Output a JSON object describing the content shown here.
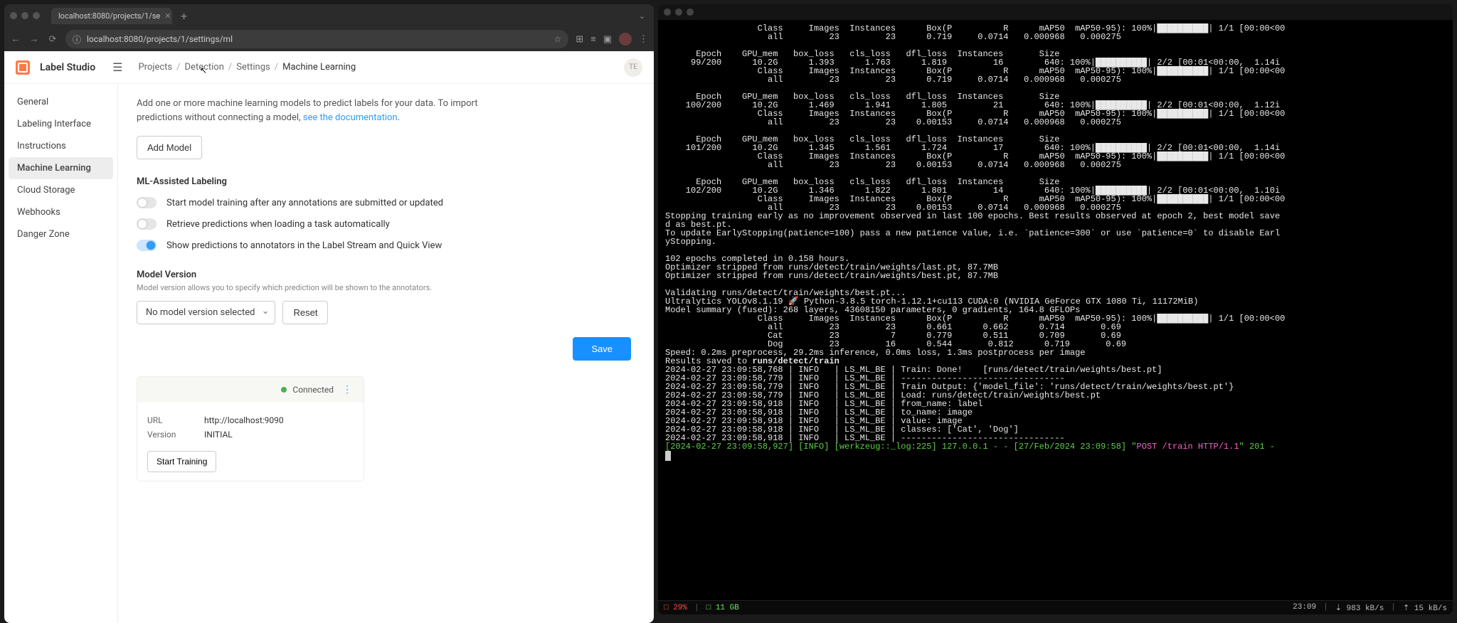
{
  "browser": {
    "tab_title": "localhost:8080/projects/1/se",
    "url": "localhost:8080/projects/1/settings/ml"
  },
  "header": {
    "brand": "Label Studio",
    "user_initials": "TE",
    "crumbs": {
      "projects": "Projects",
      "detection": "Detection",
      "settings": "Settings",
      "ml": "Machine Learning"
    }
  },
  "sidebar": {
    "general": "General",
    "labeling": "Labeling Interface",
    "instructions": "Instructions",
    "ml": "Machine Learning",
    "cloud": "Cloud Storage",
    "webhooks": "Webhooks",
    "danger": "Danger Zone"
  },
  "main": {
    "desc_pre": "Add one or more machine learning models to predict labels for your data. To import predictions without connecting a model, ",
    "desc_link": "see the documentation",
    "add_model": "Add Model",
    "assist_h": "ML-Assisted Labeling",
    "tog1": "Start model training after any annotations are submitted or updated",
    "tog2": "Retrieve predictions when loading a task automatically",
    "tog3": "Show predictions to annotators in the Label Stream and Quick View",
    "mv_h": "Model Version",
    "mv_hint": "Model version allows you to specify which prediction will be shown to the annotators.",
    "mv_select": "No model version selected",
    "reset": "Reset",
    "save": "Save"
  },
  "card": {
    "connected": "Connected",
    "url_k": "URL",
    "url_v": "http://localhost:9090",
    "ver_k": "Version",
    "ver_v": "INITIAL",
    "start": "Start Training"
  },
  "term": {
    "lines": [
      "                  Class     Images  Instances      Box(P          R      mAP50  mAP50-95): 100%|██████████| 1/1 [00:00<00",
      "                    all         23         23      0.719     0.0714   0.000968   0.000275",
      "",
      "      Epoch    GPU_mem   box_loss   cls_loss   dfl_loss  Instances       Size",
      "     99/200      10.2G      1.393      1.763      1.819         16        640: 100%|██████████| 2/2 [00:01<00:00,  1.14i",
      "                  Class     Images  Instances      Box(P          R      mAP50  mAP50-95): 100%|██████████| 1/1 [00:00<00",
      "                    all         23         23      0.719     0.0714   0.000968   0.000275",
      "",
      "      Epoch    GPU_mem   box_loss   cls_loss   dfl_loss  Instances       Size",
      "    100/200      10.2G      1.469      1.941      1.805         21        640: 100%|██████████| 2/2 [00:01<00:00,  1.12i",
      "                  Class     Images  Instances      Box(P          R      mAP50  mAP50-95): 100%|██████████| 1/1 [00:00<00",
      "                    all         23         23    0.00153     0.0714   0.000968   0.000275",
      "",
      "      Epoch    GPU_mem   box_loss   cls_loss   dfl_loss  Instances       Size",
      "    101/200      10.2G      1.345      1.561      1.724         17        640: 100%|██████████| 2/2 [00:01<00:00,  1.14i",
      "                  Class     Images  Instances      Box(P          R      mAP50  mAP50-95): 100%|██████████| 1/1 [00:00<00",
      "                    all         23         23    0.00153     0.0714   0.000968   0.000275",
      "",
      "      Epoch    GPU_mem   box_loss   cls_loss   dfl_loss  Instances       Size",
      "    102/200      10.2G      1.346      1.822      1.801         14        640: 100%|██████████| 2/2 [00:01<00:00,  1.10i",
      "                  Class     Images  Instances      Box(P          R      mAP50  mAP50-95): 100%|██████████| 1/1 [00:00<00",
      "                    all         23         23    0.00153     0.0714   0.000968   0.000275",
      "Stopping training early as no improvement observed in last 100 epochs. Best results observed at epoch 2, best model save",
      "d as best.pt.",
      "To update EarlyStopping(patience=100) pass a new patience value, i.e. `patience=300` or use `patience=0` to disable Earl",
      "yStopping.",
      "",
      "102 epochs completed in 0.158 hours.",
      "Optimizer stripped from runs/detect/train/weights/last.pt, 87.7MB",
      "Optimizer stripped from runs/detect/train/weights/best.pt, 87.7MB",
      "",
      "Validating runs/detect/train/weights/best.pt...",
      "Ultralytics YOLOv8.1.19 🚀 Python-3.8.5 torch-1.12.1+cu113 CUDA:0 (NVIDIA GeForce GTX 1080 Ti, 11172MiB)",
      "Model summary (fused): 268 layers, 43608150 parameters, 0 gradients, 164.8 GFLOPs",
      "                  Class     Images  Instances      Box(P          R      mAP50  mAP50-95): 100%|██████████| 1/1 [00:00<00",
      "                    all         23         23      0.661      0.662      0.714       0.69",
      "                    Cat         23          7      0.779      0.511      0.709       0.69",
      "                    Dog         23         16      0.544       0.812      0.719       0.69",
      "Speed: 0.2ms preprocess, 29.2ms inference, 0.0ms loss, 1.3ms postprocess per image"
    ],
    "results_line_pre": "Results saved to ",
    "results_path": "runs/detect/train",
    "log_lines": [
      "2024-02-27 23:09:58,768 | INFO   | LS_ML_BE | Train: Done!    [runs/detect/train/weights/best.pt]",
      "2024-02-27 23:09:58,779 | INFO   | LS_ML_BE | --------------------------------",
      "2024-02-27 23:09:58,779 | INFO   | LS_ML_BE | Train Output: {'model_file': 'runs/detect/train/weights/best.pt'}",
      "2024-02-27 23:09:58,779 | INFO   | LS_ML_BE | Load: runs/detect/train/weights/best.pt",
      "2024-02-27 23:09:58,918 | INFO   | LS_ML_BE | from_name: label",
      "2024-02-27 23:09:58,918 | INFO   | LS_ML_BE | to_name: image",
      "2024-02-27 23:09:58,918 | INFO   | LS_ML_BE | value: image",
      "2024-02-27 23:09:58,918 | INFO   | LS_ML_BE | classes: ['Cat', 'Dog']",
      "2024-02-27 23:09:58,918 | INFO   | LS_ML_BE | --------------------------------"
    ],
    "final_pre": "[2024-02-27 23:09:58,927] [INFO] [werkzeug::_log:225] 127.0.0.1 - - [27/Feb/2024 23:09:58] \"",
    "final_req": "POST /train HTTP/1.1",
    "final_post": "\" 201 -",
    "status": {
      "left1": "□ 29%",
      "left2": "□ 11 GB",
      "r1": "23:09",
      "r2": "⇣ 983 kB/s",
      "r3": "⇡ 15 kB/s"
    }
  }
}
